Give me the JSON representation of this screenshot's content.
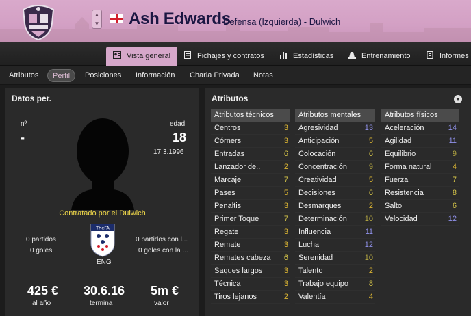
{
  "header": {
    "player_name": "Ash Edwards",
    "player_sub": "Defensa (Izquierda) - Dulwich",
    "up_arrow": "▲",
    "down_arrow": "▼"
  },
  "tabs": [
    {
      "label": "Vista general",
      "icon": "person-card-icon"
    },
    {
      "label": "Fichajes y contratos",
      "icon": "document-icon"
    },
    {
      "label": "Estadísticas",
      "icon": "bar-chart-icon"
    },
    {
      "label": "Entrenamiento",
      "icon": "cone-icon"
    },
    {
      "label": "Informes",
      "icon": "report-icon"
    }
  ],
  "subtabs": [
    "Atributos",
    "Perfil",
    "Posiciones",
    "Información",
    "Charla Privada",
    "Notas"
  ],
  "personal": {
    "title": "Datos per.",
    "number_label": "nº",
    "number_value": "-",
    "age_label": "edad",
    "age_value": "18",
    "birth_date": "17.3.1996",
    "contract_text": "Contratado por el Dulwich",
    "club_matches": "0 partidos",
    "club_goals": "0 goles",
    "intl_matches": "0 partidos con l...",
    "intl_goals": "0 goles con la ...",
    "nation": "ENG",
    "badge_text": "TheFA",
    "wage_value": "425 €",
    "wage_label": "al año",
    "expiry_value": "30.6.16",
    "expiry_label": "termina",
    "value_value": "5m €",
    "value_label": "valor"
  },
  "attributes": {
    "title": "Atributos",
    "technical": {
      "header": "Atributos técnicos",
      "rows": [
        {
          "name": "Centros",
          "value": "3"
        },
        {
          "name": "Córners",
          "value": "3"
        },
        {
          "name": "Entradas",
          "value": "6"
        },
        {
          "name": "Lanzador de..",
          "value": "2"
        },
        {
          "name": "Marcaje",
          "value": "7"
        },
        {
          "name": "Pases",
          "value": "5"
        },
        {
          "name": "Penaltis",
          "value": "3"
        },
        {
          "name": "Primer Toque",
          "value": "7"
        },
        {
          "name": "Regate",
          "value": "3"
        },
        {
          "name": "Remate",
          "value": "3"
        },
        {
          "name": "Remates cabeza",
          "value": "6"
        },
        {
          "name": "Saques largos",
          "value": "3"
        },
        {
          "name": "Técnica",
          "value": "3"
        },
        {
          "name": "Tiros lejanos",
          "value": "2"
        }
      ]
    },
    "mental": {
      "header": "Atributos mentales",
      "rows": [
        {
          "name": "Agresividad",
          "value": "13"
        },
        {
          "name": "Anticipación",
          "value": "5"
        },
        {
          "name": "Colocación",
          "value": "6"
        },
        {
          "name": "Concentración",
          "value": "9"
        },
        {
          "name": "Creatividad",
          "value": "5"
        },
        {
          "name": "Decisiones",
          "value": "6"
        },
        {
          "name": "Desmarques",
          "value": "2"
        },
        {
          "name": "Determinación",
          "value": "10"
        },
        {
          "name": "Influencia",
          "value": "11"
        },
        {
          "name": "Lucha",
          "value": "12"
        },
        {
          "name": "Serenidad",
          "value": "10"
        },
        {
          "name": "Talento",
          "value": "2"
        },
        {
          "name": "Trabajo equipo",
          "value": "8"
        },
        {
          "name": "Valentía",
          "value": "4"
        }
      ]
    },
    "physical": {
      "header": "Atributos físicos",
      "rows": [
        {
          "name": "Aceleración",
          "value": "14"
        },
        {
          "name": "Agilidad",
          "value": "11"
        },
        {
          "name": "Equilibrio",
          "value": "9"
        },
        {
          "name": "Forma natural",
          "value": "4"
        },
        {
          "name": "Fuerza",
          "value": "7"
        },
        {
          "name": "Resistencia",
          "value": "8"
        },
        {
          "name": "Salto",
          "value": "6"
        },
        {
          "name": "Velocidad",
          "value": "12"
        }
      ]
    }
  },
  "colors": {
    "club_pink": "#d6a7ca",
    "value_low": "#e0b933",
    "value_mid": "#b3a642",
    "value_high": "#8f90e8"
  }
}
